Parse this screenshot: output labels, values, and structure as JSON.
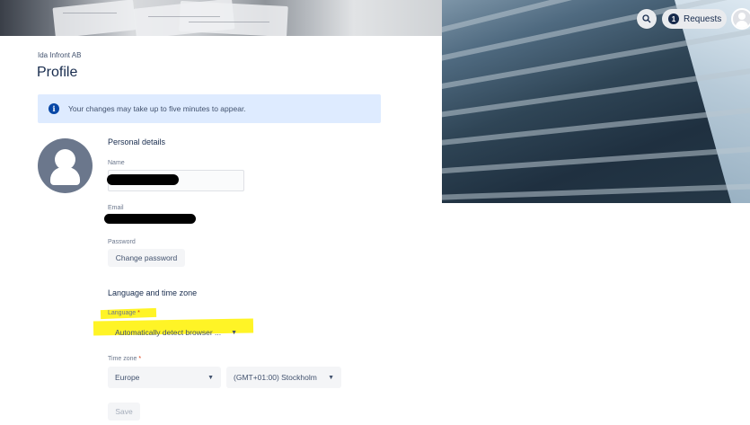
{
  "header": {
    "requests_label": "Requests",
    "requests_count": "1",
    "search_icon": "search-icon",
    "avatar_icon": "user-avatar-icon"
  },
  "profile": {
    "org_name": "Ida Infront AB",
    "title": "Profile",
    "banner_text": "Your changes may take up to five minutes to appear.",
    "personal_details_heading": "Personal details",
    "name_label": "Name",
    "email_label": "Email",
    "password_label": "Password",
    "change_password_label": "Change password",
    "language_timezone_heading": "Language and time zone",
    "language_label": "Language",
    "language_value": "Automatically detect browser ...",
    "timezone_label": "Time zone",
    "region_value": "Europe",
    "timezone_value": "(GMT+01:00) Stockholm",
    "required_marker": "*",
    "save_label": "Save"
  },
  "colors": {
    "banner_bg": "#deebff",
    "info_icon": "#0747a6",
    "highlight": "#fff200",
    "required": "#de350b"
  }
}
